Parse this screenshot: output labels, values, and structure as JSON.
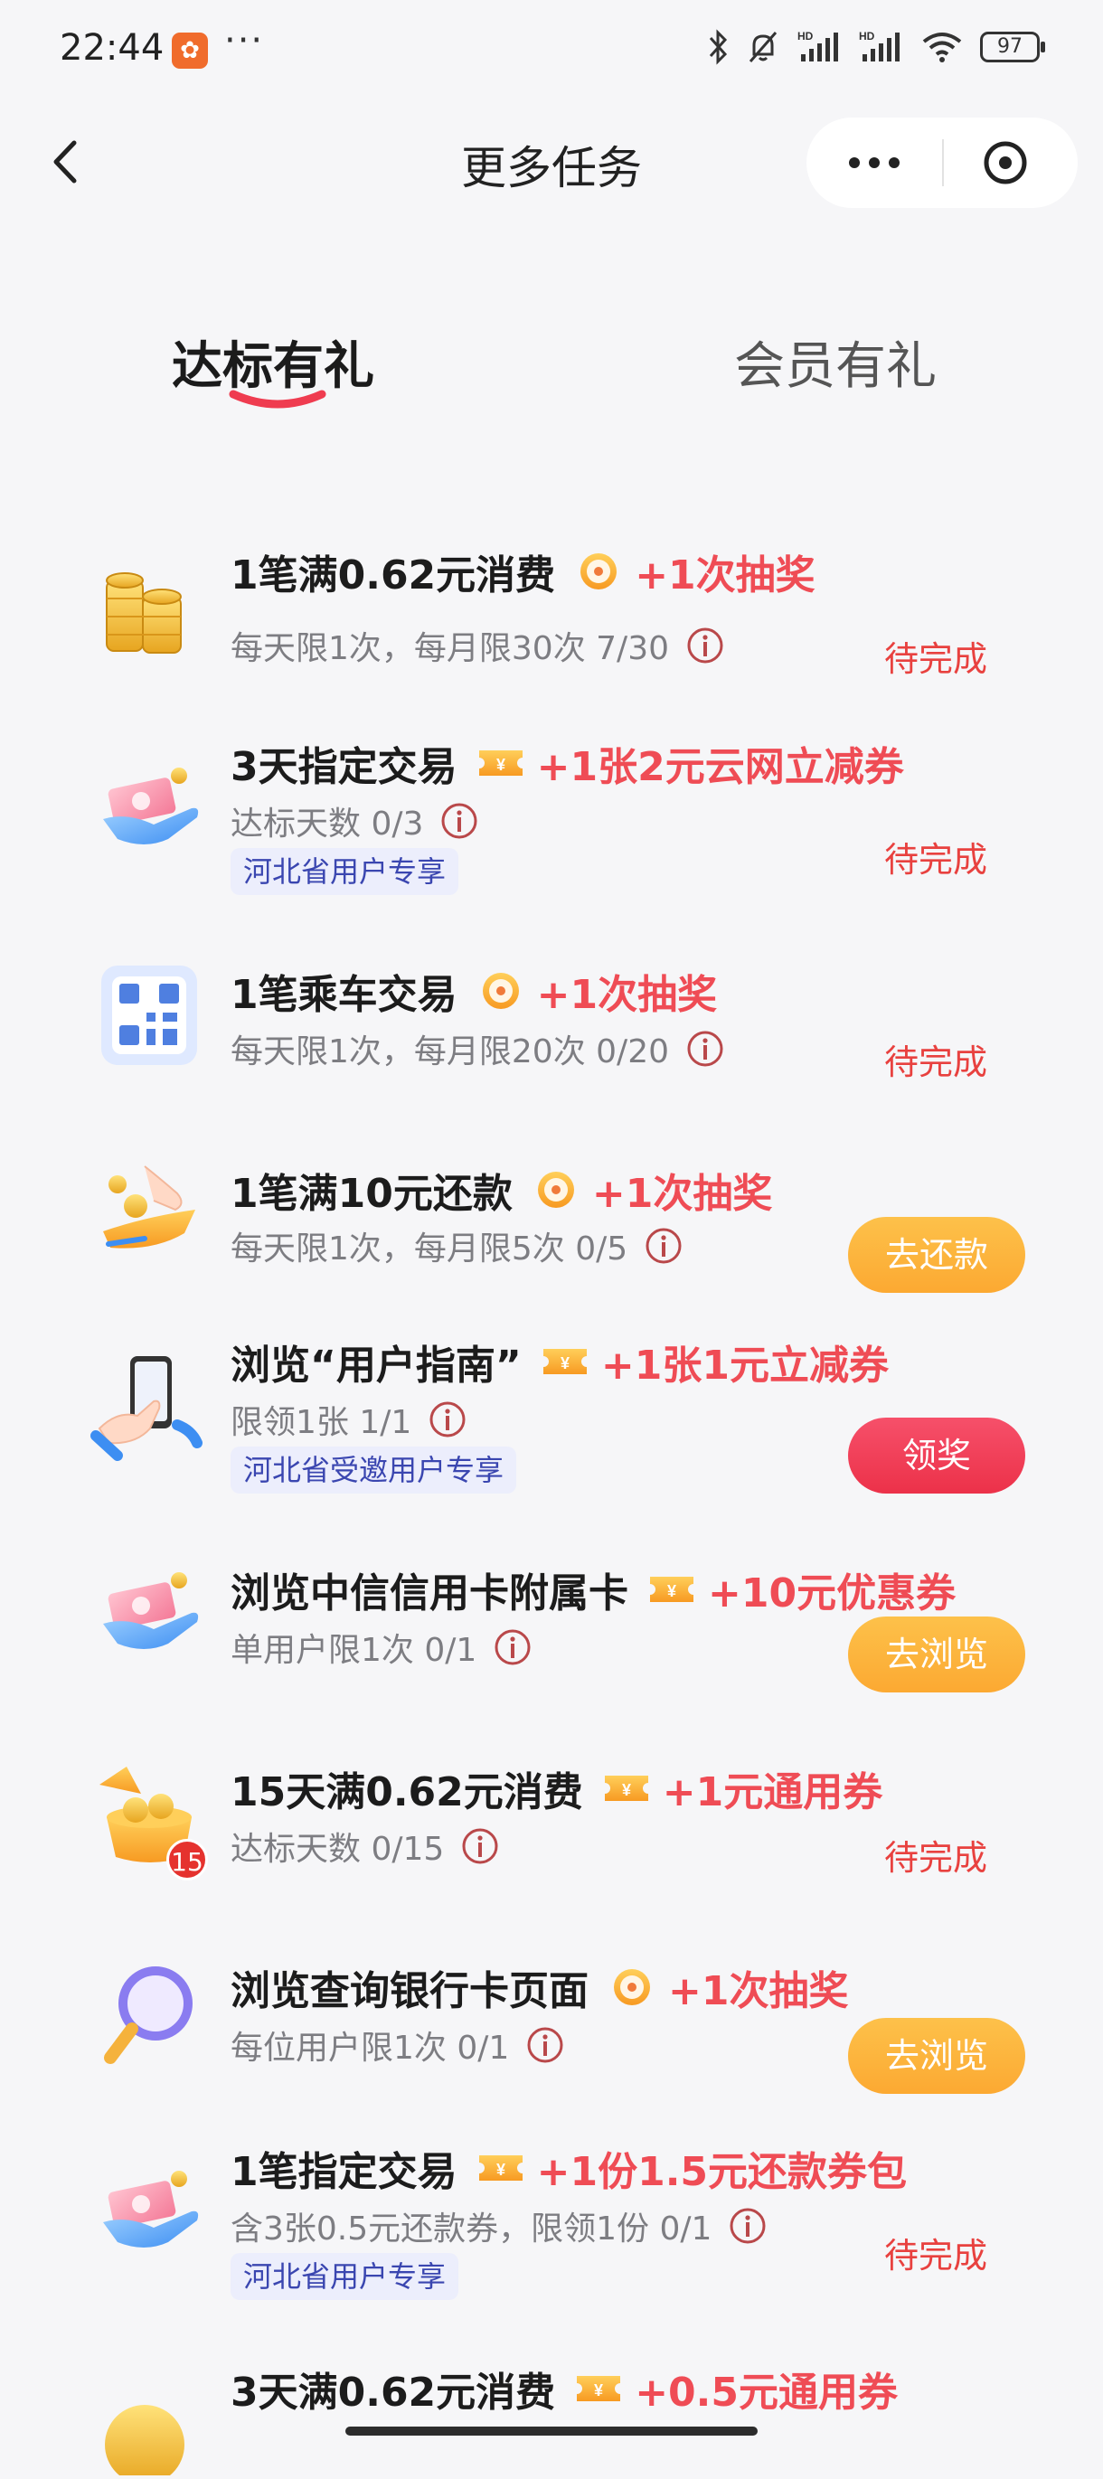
{
  "status_bar": {
    "time": "22:44",
    "app_badge": "",
    "more": "···",
    "battery": "97",
    "icons": [
      "bluetooth-icon",
      "mute-bell-icon",
      "signal-hd-icon",
      "signal-hd-icon",
      "wifi-icon",
      "battery-icon"
    ]
  },
  "nav": {
    "title": "更多任务",
    "icons": [
      "back-arrow-icon",
      "more-dots-icon",
      "close-circle-icon"
    ]
  },
  "tabs": [
    {
      "label": "达标有礼",
      "active": true
    },
    {
      "label": "会员有礼",
      "active": false
    }
  ],
  "colors": {
    "accent_red": "#ef4c55",
    "status_red": "#e8413f",
    "button_orange": "#fcb13c",
    "button_red": "#ec3149",
    "badge_bg": "#eceefc",
    "badge_text": "#3a46b0"
  },
  "tasks": [
    {
      "icon": "gold-coins-icon",
      "title": "1笔满0.62元消费",
      "reward_icon": "lottery-disc-icon",
      "reward": "+1次抽奖",
      "sub": "每天限1次，每月限30次  7/30",
      "badge": "",
      "status": "待完成",
      "button": ""
    },
    {
      "icon": "hand-money-icon",
      "title": "3天指定交易",
      "reward_icon": "coupon-ticket-icon",
      "reward": "+1张2元云网立减券",
      "sub": "达标天数  0/3",
      "badge": "河北省用户专享",
      "status": "待完成",
      "button": ""
    },
    {
      "icon": "qr-code-icon",
      "title": "1笔乘车交易",
      "reward_icon": "lottery-disc-icon",
      "reward": "+1次抽奖",
      "sub": "每天限1次，每月限20次  0/20",
      "badge": "",
      "status": "待完成",
      "button": ""
    },
    {
      "icon": "hand-coins-icon",
      "title": "1笔满10元还款",
      "reward_icon": "lottery-disc-icon",
      "reward": "+1次抽奖",
      "sub": "每天限1次，每月限5次  0/5",
      "badge": "",
      "status": "",
      "button": "去还款"
    },
    {
      "icon": "phone-hand-icon",
      "title": "浏览“用户指南”",
      "reward_icon": "coupon-ticket-icon",
      "reward": "+1张1元立减券",
      "sub": "限领1张  1/1",
      "badge": "河北省受邀用户专享",
      "status": "",
      "button": "领奖"
    },
    {
      "icon": "hand-money-icon",
      "title": "浏览中信信用卡附属卡",
      "reward_icon": "coupon-ticket-icon",
      "reward": "+10元优惠券",
      "sub": "单用户限1次  0/1",
      "badge": "",
      "status": "",
      "button": "去浏览"
    },
    {
      "icon": "coin-bowl-icon",
      "title": "15天满0.62元消费",
      "reward_icon": "coupon-ticket-icon",
      "reward": "+1元通用券",
      "sub": "达标天数  0/15",
      "badge": "",
      "status": "待完成",
      "button": "",
      "icon_badge": "15"
    },
    {
      "icon": "magnifier-icon",
      "title": "浏览查询银行卡页面",
      "reward_icon": "lottery-disc-icon",
      "reward": "+1次抽奖",
      "sub": "每位用户限1次  0/1",
      "badge": "",
      "status": "",
      "button": "去浏览"
    },
    {
      "icon": "hand-money-icon",
      "title": "1笔指定交易",
      "reward_icon": "coupon-ticket-icon",
      "reward": "+1份1.5元还款券包",
      "sub": "含3张0.5元还款券，限领1份  0/1",
      "badge": "河北省用户专享",
      "status": "待完成",
      "button": ""
    },
    {
      "icon": "gold-coin-icon",
      "title": "3天满0.62元消费",
      "reward_icon": "coupon-ticket-icon",
      "reward": "+0.5元通用券",
      "sub": "",
      "badge": "",
      "status": "",
      "button": ""
    }
  ]
}
